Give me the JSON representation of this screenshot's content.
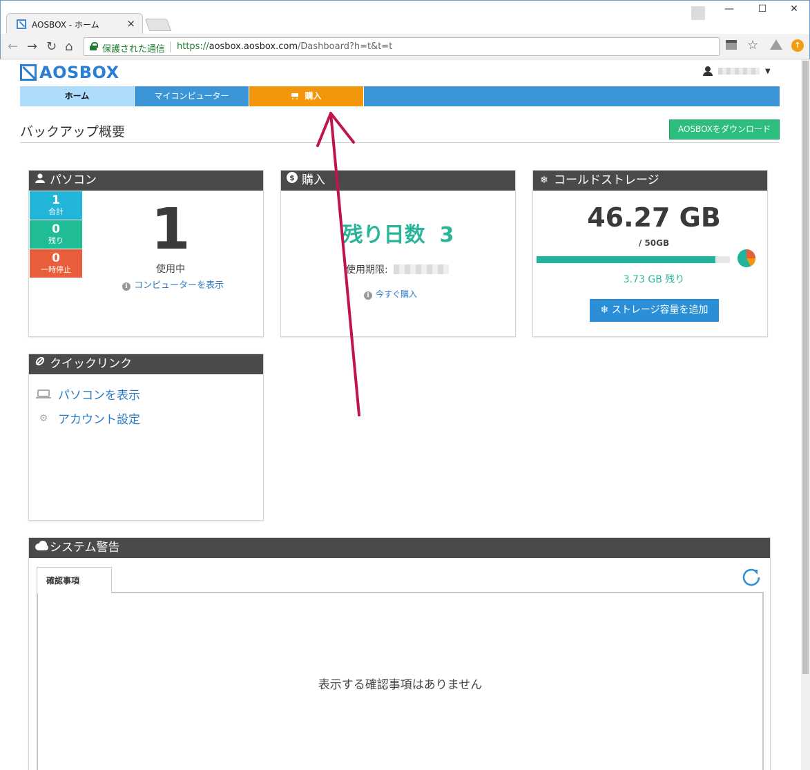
{
  "browser": {
    "tab_title": "AOSBOX - ホーム",
    "tab_close": "×",
    "secure_label": "保護された通信",
    "url_scheme": "https://",
    "url_host": "aosbox.aosbox.com",
    "url_path": "/Dashboard?h=t&t=t",
    "win_minimize": "—",
    "win_maximize": "☐",
    "win_close": "✕",
    "back": "←",
    "forward": "→",
    "reload": "↻",
    "home": "⌂",
    "star": "☆",
    "ext_badge": "↑"
  },
  "header": {
    "logo": "AOSBOX",
    "user_caret": "▼"
  },
  "nav": {
    "home": "ホーム",
    "my_computer": "マイコンピューター",
    "buy": "購入"
  },
  "page": {
    "title": "バックアップ概要",
    "download_button": "AOSBOXをダウンロード"
  },
  "pc_card": {
    "title": "パソコン",
    "total_num": "1",
    "total_label": "合計",
    "left_num": "0",
    "left_label": "残り",
    "paused_num": "0",
    "paused_label": "一時停止",
    "big_count": "1",
    "in_use": "使用中",
    "view_link": "コンピューターを表示"
  },
  "buy_card": {
    "title": "購入",
    "days_label": "残り日数",
    "days_value": "3",
    "expiry_label": "使用期限:",
    "buy_now": "今すぐ購入"
  },
  "cold_card": {
    "title": "コールドストレージ",
    "used": "46.27 GB",
    "total": "/ 50GB",
    "used_fraction": 0.925,
    "remaining": "3.73 GB 残り",
    "add_button": "ストレージ容量を追加"
  },
  "quicklinks": {
    "title": "クイックリンク",
    "view_pc": "パソコンを表示",
    "account": "アカウント設定"
  },
  "system": {
    "title": "システム警告",
    "tab_label": "確認事項",
    "empty_message": "表示する確認事項はありません"
  },
  "colors": {
    "brand_blue": "#2b7fd1",
    "nav_blue": "#3b95d6",
    "nav_orange": "#f3960b",
    "teal": "#2ab59a",
    "download_green": "#2dbe7d",
    "paused_red": "#e85d3a",
    "annotation_arrow": "#c0144d"
  }
}
